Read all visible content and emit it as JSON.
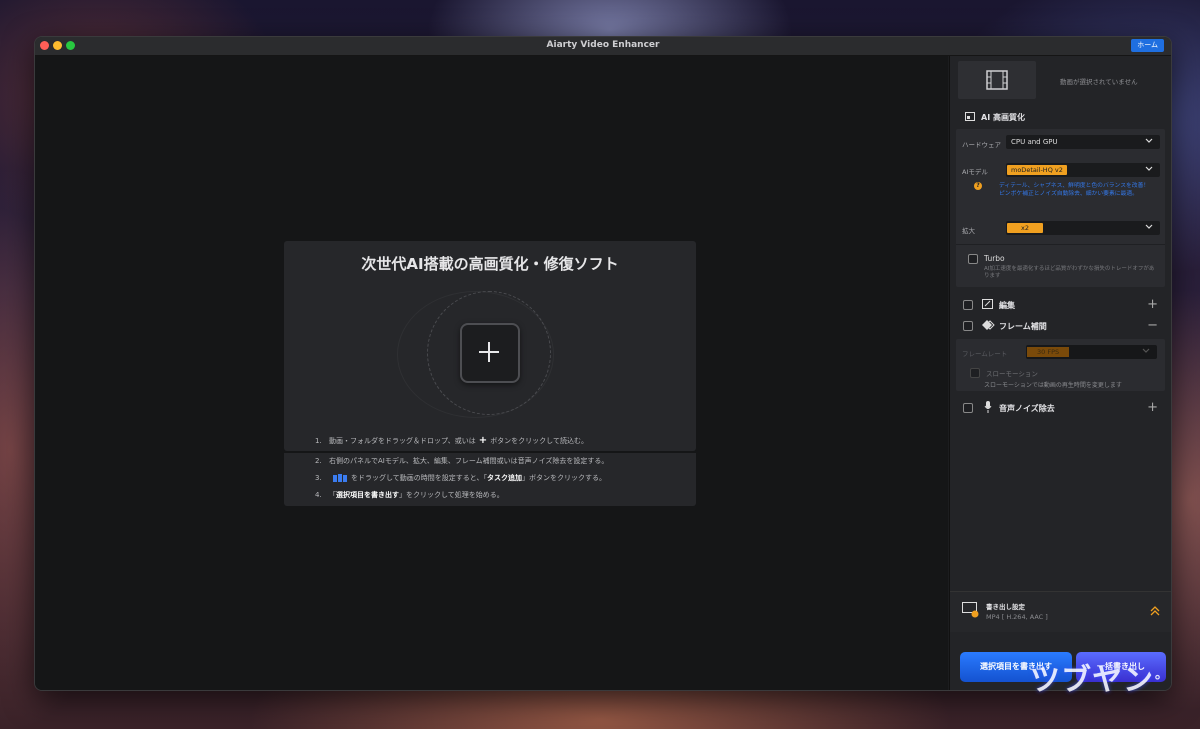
{
  "window": {
    "title": "Aiarty Video Enhancer",
    "home_button": "ホーム"
  },
  "main": {
    "title": "次世代AI搭載の高画質化・修復ソフト",
    "steps": [
      {
        "num": "1.",
        "pre": "動画・フォルダをドラッグ＆ドロップ、或いは",
        "post": "ボタンをクリックして読込む。"
      },
      {
        "num": "2.",
        "text": "右側のパネルでAIモデル、拡大、編集、フレーム補間或いは音声ノイズ除去を設定する。"
      },
      {
        "num": "3.",
        "pre": "をドラッグして動画の時間を設定すると、「",
        "bold": "タスク追加",
        "post": "」ボタンをクリックする。"
      },
      {
        "num": "4.",
        "pre": "「",
        "bold": "選択項目を書き出す",
        "post": "」をクリックして処理を始める。"
      }
    ]
  },
  "sidebar": {
    "no_video": "動画が選択されていません",
    "ai_section": "AI 高画質化",
    "hardware_label": "ハードウェア",
    "hardware_value": "CPU and GPU",
    "ai_model_label": "AIモデル",
    "ai_model_value": "moDetail-HQ  v2",
    "ai_model_help_line1": "ディテール、シャプネス、鮮明度と色のバランスを改善！",
    "ai_model_help_line2": "ピンボケ補正とノイズ自動除去、細かい要素に最適。",
    "scale_label": "拡大",
    "scale_value": "x2",
    "turbo_label": "Turbo",
    "turbo_help_line1": "AI加工速度を最適化するほど品質がわずかな損失のトレードオフがあ",
    "turbo_help_line2": "ります",
    "edit_label": "編集",
    "frame_interp_label": "フレーム補間",
    "frame_rate_label": "フレームレート",
    "frame_rate_value": "30 FPS",
    "slow_motion_label": "スローモーション",
    "slow_motion_help": "スローモーションでは動画の再生時間を変更します",
    "audio_noise_label": "音声ノイズ除去",
    "export_settings_label": "書き出し設定",
    "export_format": "MP4 [ H.264, AAC ]",
    "export_selected_button": "選択項目を書き出す",
    "export_all_button": "一括書き出し"
  },
  "watermark": "ツブヤン"
}
